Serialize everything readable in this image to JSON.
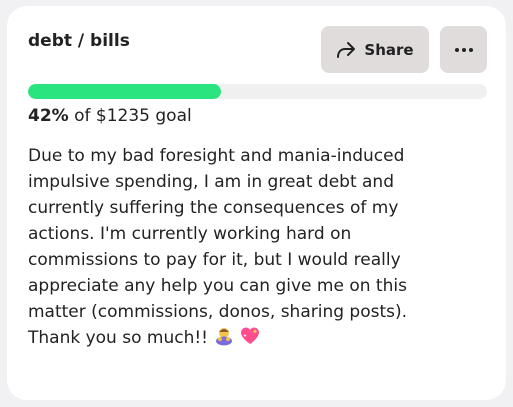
{
  "campaign": {
    "title": "debt / bills",
    "share_label": "Share",
    "progress_percent": 42,
    "progress_percent_text": "42%",
    "goal_text": " of $1235 goal",
    "description": "Due to my bad foresight and mania-induced impulsive spending, I am in great debt and currently suffering the consequences of my actions. I'm currently working hard on commissions to pay for it, but I would really appreciate any help you can give me on this matter (commissions, donos, sharing posts). Thank you so much!!",
    "emojis": [
      "person-bowing-emoji",
      "sparkling-heart-emoji"
    ]
  },
  "colors": {
    "progress_fill": "#2ae47f",
    "progress_track": "#f0f0f0",
    "button_bg": "#e0dcdc",
    "card_bg": "#ffffff",
    "page_bg": "#f1f1f3"
  },
  "icons": {
    "share": "share-arrow-icon",
    "more": "more-dots-icon"
  }
}
